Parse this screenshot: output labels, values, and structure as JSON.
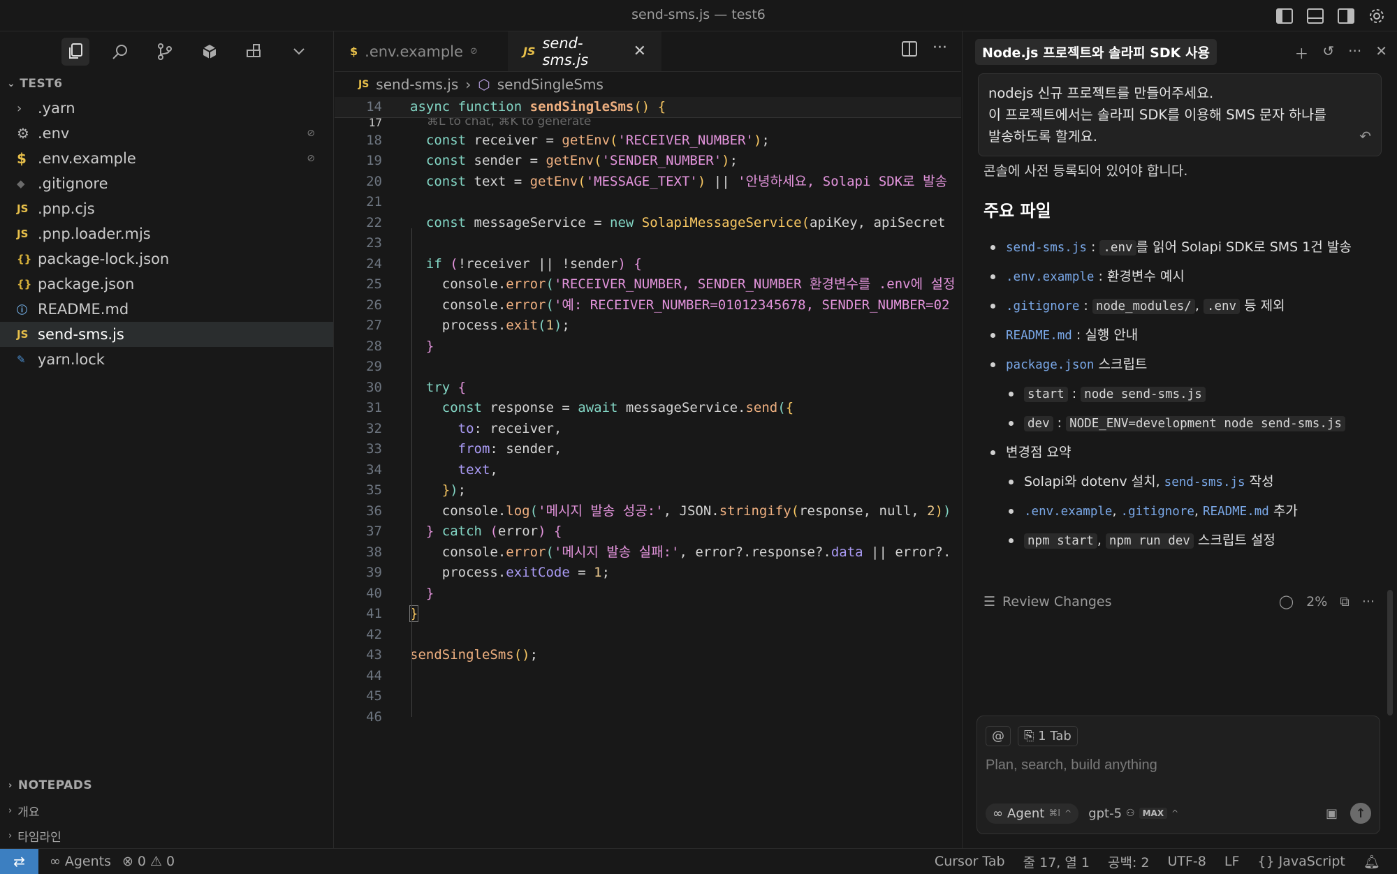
{
  "window": {
    "title": "send-sms.js — test6"
  },
  "titlebar_icons": [
    "sidebar-left-icon",
    "panel-bottom-icon",
    "sidebar-right-icon",
    "gear-icon"
  ],
  "sidebar": {
    "tools": [
      "files-icon",
      "search-icon",
      "source-control-icon",
      "extensions-box-icon",
      "blocks-icon",
      "chevron-down-icon"
    ],
    "section_title": "TEST6",
    "files": [
      {
        "name": ".yarn",
        "icon": "chevron-right-icon",
        "kind": "folder"
      },
      {
        "name": ".env",
        "icon": "gear-icon",
        "kind": "env"
      },
      {
        "name": ".env.example",
        "icon": "dollar-icon",
        "kind": "env"
      },
      {
        "name": ".gitignore",
        "icon": "git-icon",
        "kind": "git"
      },
      {
        "name": ".pnp.cjs",
        "icon": "js-icon",
        "kind": "js"
      },
      {
        "name": ".pnp.loader.mjs",
        "icon": "js-icon",
        "kind": "js"
      },
      {
        "name": "package-lock.json",
        "icon": "json-icon",
        "kind": "json"
      },
      {
        "name": "package.json",
        "icon": "json-icon",
        "kind": "json"
      },
      {
        "name": "README.md",
        "icon": "info-icon",
        "kind": "info"
      },
      {
        "name": "send-sms.js",
        "icon": "js-icon",
        "kind": "js"
      },
      {
        "name": "yarn.lock",
        "icon": "yarn-icon",
        "kind": "yarn"
      }
    ],
    "bottom_sections": [
      {
        "label": "NOTEPADS"
      },
      {
        "label": "개요"
      },
      {
        "label": "타임라인"
      }
    ]
  },
  "editor": {
    "tabs": [
      {
        "label": ".env.example",
        "icon_text": "$"
      },
      {
        "label": "send-sms.js",
        "icon_text": "JS"
      }
    ],
    "breadcrumb": {
      "file": "send-sms.js",
      "symbol": "sendSingleSms"
    },
    "inline_hint": "⌘L to chat, ⌘K to generate",
    "lines": [
      {
        "n": "14"
      },
      {
        "n": "17"
      },
      {
        "n": "18"
      },
      {
        "n": "19"
      },
      {
        "n": "20"
      },
      {
        "n": "21"
      },
      {
        "n": "22"
      },
      {
        "n": "23"
      },
      {
        "n": "24"
      },
      {
        "n": "25"
      },
      {
        "n": "26"
      },
      {
        "n": "27"
      },
      {
        "n": "28"
      },
      {
        "n": "29"
      },
      {
        "n": "30"
      },
      {
        "n": "31"
      },
      {
        "n": "32"
      },
      {
        "n": "33"
      },
      {
        "n": "34"
      },
      {
        "n": "35"
      },
      {
        "n": "36"
      },
      {
        "n": "37"
      },
      {
        "n": "38"
      },
      {
        "n": "39"
      },
      {
        "n": "40"
      },
      {
        "n": "41"
      },
      {
        "n": "42"
      },
      {
        "n": "43"
      },
      {
        "n": "44"
      },
      {
        "n": "45"
      },
      {
        "n": "46"
      }
    ],
    "code": {
      "l14_kw1": "async",
      "l14_kw2": "function",
      "l14_fn": "sendSingleSms",
      "l18_fn": "getEnv",
      "l18_str": "'RECEIVER_NUMBER'",
      "l19_fn": "getEnv",
      "l19_str": "'SENDER_NUMBER'",
      "l20_fn": "getEnv",
      "l20_str": "'MESSAGE_TEXT'",
      "l20_str2": "'안녕하세요, Solapi SDK로 발송",
      "l22_cls": "SolapiMessageService",
      "l22_args": "apiKey, apiSecret",
      "l25_str": "'RECEIVER_NUMBER, SENDER_NUMBER 환경변수를 .env에 설정",
      "l26_str": "'예: RECEIVER_NUMBER=01012345678, SENDER_NUMBER=02",
      "l36_str": "'메시지 발송 성공:'",
      "l38_str": "'메시지 발송 실패:'",
      "l43_fn": "sendSingleSms"
    }
  },
  "chat": {
    "tab_title": "Node.js 프로젝트와 솔라피 SDK 사용",
    "user_message": {
      "line1": "nodejs 신규 프로젝트를 만들어주세요.",
      "line2": "이 프로젝트에서는 솔라피 SDK를 이용해 SMS 문자 하나를",
      "line3": "발송하도록 할게요."
    },
    "cut_text": "콘솔에 사전 등록되어 있어야 합니다.",
    "section_title": "주요 파일",
    "items": {
      "i1_code": "send-sms.js",
      "i1_code2": ".env",
      "i1_text": "를 읽어 Solapi SDK로 SMS 1건 발송",
      "i2_code": ".env.example",
      "i2_text": ": 환경변수 예시",
      "i3_code": ".gitignore",
      "i3_code2": "node_modules/",
      "i3_code3": ".env",
      "i3_text": "등 제외",
      "i4_code": "README.md",
      "i4_text": ": 실행 안내",
      "i5_code": "package.json",
      "i5_text": "스크립트",
      "i6_code": "start",
      "i6_code2": "node send-sms.js",
      "i7_code": "dev",
      "i7_code2": "NODE_ENV=development node send-sms.js",
      "i8_text": "변경점 요약",
      "i9_text": "Solapi와 dotenv 설치,",
      "i9_code": "send-sms.js",
      "i9_text2": "작성",
      "i10_code": ".env.example",
      "i10_code2": ".gitignore",
      "i10_code3": "README.md",
      "i10_text": "추가",
      "i11_code": "npm start",
      "i11_code2": "npm run dev",
      "i11_text": "스크립트 설정"
    },
    "review": {
      "label": "Review Changes",
      "progress": "2%"
    },
    "composer": {
      "mention": "@",
      "tab_pill": "1 Tab",
      "placeholder": "Plan, search, build anything",
      "agent_label": "Agent",
      "agent_kbd": "⌘I",
      "model": "gpt-5",
      "max_badge": "MAX"
    }
  },
  "statusbar": {
    "agents": "Agents",
    "errors": "0",
    "warnings": "0",
    "cursor_tab": "Cursor Tab",
    "position": "줄 17, 열 1",
    "spaces": "공백: 2",
    "encoding": "UTF-8",
    "eol": "LF",
    "language": "JavaScript"
  },
  "colors": {
    "accent": "#3c7fc1",
    "background": "#181818",
    "js_icon": "#e8c04a"
  }
}
